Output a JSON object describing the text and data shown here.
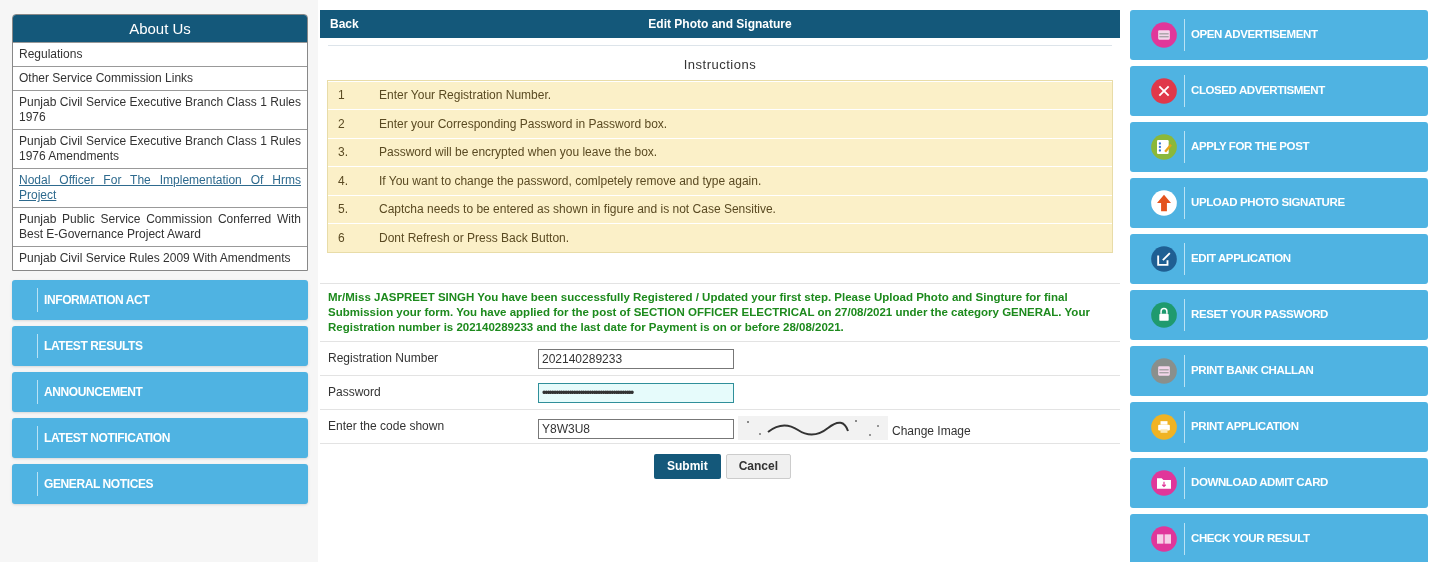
{
  "about": {
    "title": "About Us",
    "items": [
      {
        "label": "Regulations",
        "kind": "text"
      },
      {
        "label": "Other Service Commission Links",
        "kind": "text"
      },
      {
        "label": "Punjab Civil Service Executive Branch Class 1 Rules 1976",
        "kind": "text"
      },
      {
        "label": "Punjab Civil Service Executive Branch Class 1 Rules 1976 Amendments",
        "kind": "text"
      },
      {
        "label": "Nodal Officer For The Implementation Of Hrms Project",
        "kind": "link"
      },
      {
        "label": "Punjab Public Service Commission Conferred With Best E-Governance Project Award",
        "kind": "text"
      },
      {
        "label": "Punjab Civil Service Rules 2009 With Amendments",
        "kind": "text"
      }
    ]
  },
  "left_menu": [
    "INFORMATION ACT",
    "LATEST RESULTS",
    "ANNOUNCEMENT",
    "LATEST NOTIFICATION",
    "GENERAL NOTICES"
  ],
  "header": {
    "back": "Back",
    "title": "Edit Photo and Signature"
  },
  "instructions": {
    "title": "Instructions",
    "rows": [
      {
        "number": "1",
        "text": "Enter Your Registration Number."
      },
      {
        "number": "2",
        "text": "Enter your Corresponding Password in Password box."
      },
      {
        "number": "3.",
        "text": "Password will be encrypted when you leave the box."
      },
      {
        "number": "4.",
        "text": "If You want to change the password, comlpetely remove and type again."
      },
      {
        "number": "5.",
        "text": "Captcha needs to be entered as shown in figure and is not Case Sensitive."
      },
      {
        "number": "6",
        "text": "Dont Refresh or Press Back Button."
      }
    ]
  },
  "message": "Mr/Miss JASPREET SINGH You have been successfully Registered / Updated your first step. Please Upload Photo and Singture for final Submission your form. You have applied for the post of SECTION OFFICER ELECTRICAL on 27/08/2021 under the category GENERAL. Your Registration number is 202140289233 and the last date for Payment is on or before 28/08/2021.",
  "form": [
    {
      "label": "Registration Number",
      "value": "202140289233",
      "kind": "text",
      "focused": false
    },
    {
      "label": "Password",
      "value": "•••••••••••••••••••••••••••••••••••••••••",
      "kind": "text",
      "focused": true
    },
    {
      "label": "Enter the code shown",
      "value": "Y8W3U8",
      "kind": "captcha",
      "focused": false,
      "link": "Change Image"
    }
  ],
  "buttons": {
    "submit": "Submit",
    "cancel": "Cancel"
  },
  "right_menu": [
    {
      "label": "OPEN ADVERTISEMENT",
      "kind": "document",
      "color": "#e0369a"
    },
    {
      "label": "CLOSED ADVERTISMENT",
      "kind": "close",
      "color": "#e0384a"
    },
    {
      "label": "APPLY FOR THE POST",
      "kind": "checklist",
      "color": "#8bb83a"
    },
    {
      "label": "UPLOAD PHOTO SIGNATURE",
      "kind": "upload",
      "color": "#ffffff"
    },
    {
      "label": "EDIT APPLICATION",
      "kind": "edit",
      "color": "#1f5f93"
    },
    {
      "label": "RESET YOUR PASSWORD",
      "kind": "lock",
      "color": "#1f9a6e"
    },
    {
      "label": "PRINT BANK CHALLAN",
      "kind": "document",
      "color": "#8a8f8c"
    },
    {
      "label": "PRINT APPLICATION",
      "kind": "printer",
      "color": "#f0b323"
    },
    {
      "label": "DOWNLOAD ADMIT CARD",
      "kind": "folder",
      "color": "#e0369a"
    },
    {
      "label": "CHECK YOUR RESULT",
      "kind": "book",
      "color": "#e0369a"
    }
  ]
}
